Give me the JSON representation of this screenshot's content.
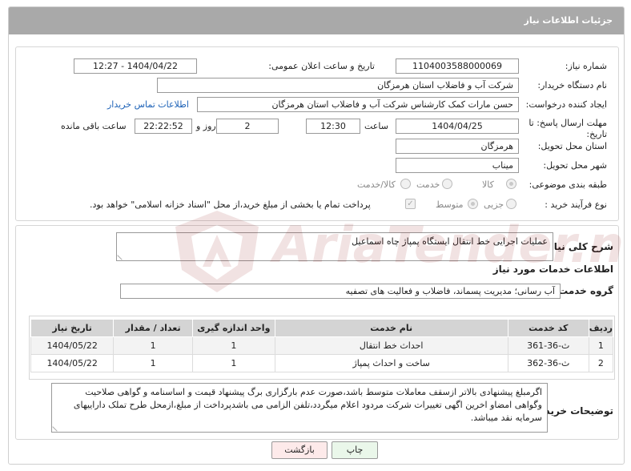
{
  "header": {
    "title": "جزئیات اطلاعات نیاز"
  },
  "fields": {
    "need_number_label": "شماره نیاز:",
    "need_number": "1104003588000069",
    "announce_label": "تاریخ و ساعت اعلان عمومی:",
    "announce_value": "1404/04/22 - 12:27",
    "buyer_org_label": "نام دستگاه خریدار:",
    "buyer_org": "شرکت آب و فاضلاب استان هرمزگان",
    "creator_label": "ایجاد کننده درخواست:",
    "creator": "حسن مارات کمک کارشناس شرکت آب و فاضلاب استان هرمزگان",
    "contact_link": "اطلاعات تماس خریدار",
    "deadline_label": "مهلت ارسال پاسخ: تا تاریخ:",
    "deadline_date": "1404/04/25",
    "time_label": "ساعت",
    "deadline_time": "12:30",
    "days_value": "2",
    "days_label": "روز و",
    "remaining_value": "22:22:52",
    "remaining_label": "ساعت باقی مانده",
    "province_label": "استان محل تحویل:",
    "province": "هرمزگان",
    "city_label": "شهر محل تحویل:",
    "city": "میناب",
    "category_label": "طبقه بندی موضوعی:",
    "category_options": [
      "کالا",
      "خدمت",
      "کالا/خدمت"
    ],
    "purchase_type_label": "نوع فرآیند خرید :",
    "purchase_options": [
      "جزیی",
      "متوسط"
    ],
    "payment_note": "پرداخت تمام یا بخشی از مبلغ خرید،از محل \"اسناد خزانه اسلامی\" خواهد بود."
  },
  "summary": {
    "label": "شرح کلی نیاز:",
    "text": "عملیات اجرایی خط انتقال ایستگاه پمپاژ چاه اسماعیل"
  },
  "services": {
    "section_title": "اطلاعات خدمات مورد نیاز",
    "group_label": "گروه خدمت:",
    "group_value": "آب رسانی؛ مدیریت پسماند، فاضلاب و فعالیت های تصفیه",
    "columns": [
      "ردیف",
      "کد خدمت",
      "نام خدمت",
      "واحد اندازه گیری",
      "تعداد / مقدار",
      "تاریخ نیاز"
    ],
    "rows": [
      [
        "1",
        "ث-36-361",
        "احداث خط انتقال",
        "1",
        "1",
        "1404/05/22"
      ],
      [
        "2",
        "ث-36-362",
        "ساخت و احداث پمپاژ",
        "1",
        "1",
        "1404/05/22"
      ]
    ]
  },
  "buyer_notes": {
    "label": "توضیحات خریدار:",
    "text": "اگرمبلغ پیشنهادی بالاتر ازسقف معاملات متوسط باشد،صورت عدم بارگزاری برگ پیشنهاد قیمت و اساسنامه و گواهی صلاحیت وگواهی امضاو اخرین اگهی تغییرات شرکت مردود اعلام میگردد،تلفن الزامی می باشدپرداخت از مبلغ،ازمحل طرح تملک داراییهای سرمایه نقد میباشد."
  },
  "buttons": {
    "print": "چاپ",
    "back": "بازگشت"
  },
  "watermark": {
    "text": "AriaTender.neT"
  },
  "colors": {
    "header_bg": "#a9a9a9",
    "link": "#1d62b7",
    "table_header": "#d4d4d4"
  }
}
